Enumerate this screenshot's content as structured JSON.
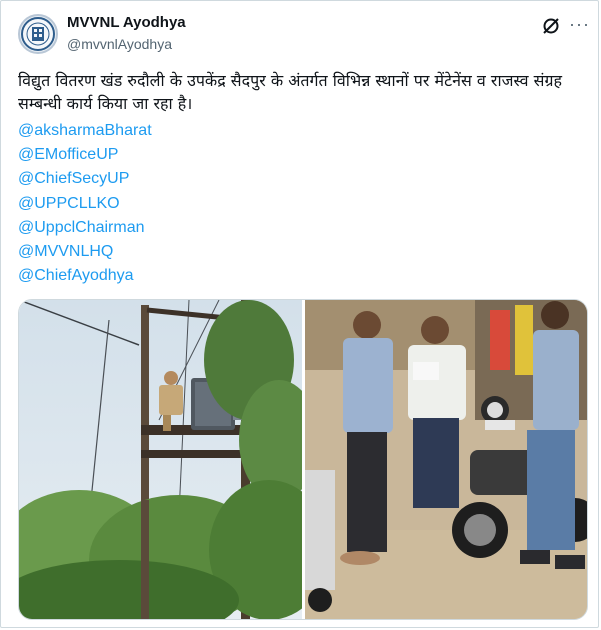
{
  "author": {
    "name": "MVVNL Ayodhya",
    "handle": "@mvvnlAyodhya",
    "avatar_icon": "utility-logo-icon"
  },
  "actions": {
    "grok_icon": "grok-icon",
    "more_label": "···"
  },
  "post": {
    "text": "विद्युत वितरण खंड रुदौली के उपकेंद्र सैदपुर के अंतर्गत विभिन्न स्थानों पर  मेंटेनेंस व राजस्व संग्रह सम्बन्धी कार्य किया जा रहा है।",
    "mentions": [
      "@aksharmaBharat",
      "@EMofficeUP",
      "@ChiefSecyUP",
      "@UPPCLLKO",
      "@UppclChairman",
      "@MVVNLHQ",
      "@ChiefAyodhya"
    ]
  },
  "colors": {
    "link": "#1d9bf0",
    "secondary_text": "#536471",
    "border": "#cfd9de"
  }
}
